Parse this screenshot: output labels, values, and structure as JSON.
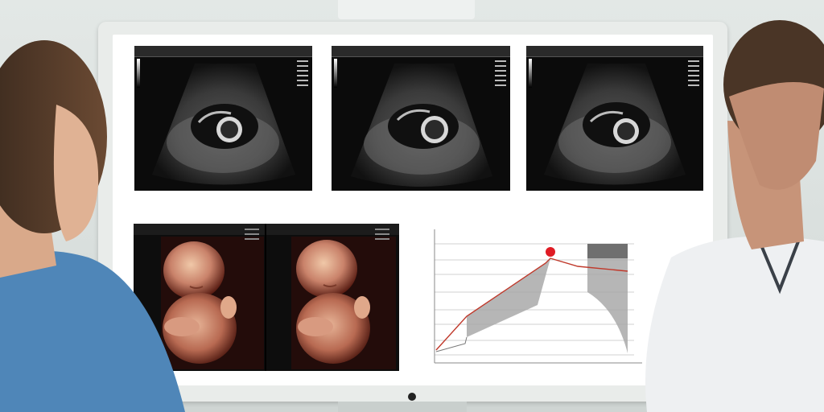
{
  "colors": {
    "wall": "#dde3e1",
    "monitor_bezel": "#e9ecea",
    "screen": "#ffffff",
    "ultrasound_bg": "#0b0b0b",
    "chart_fill": "#a9a9a9",
    "chart_line": "#c0392b",
    "marker": "#e01b24",
    "scrub_blue": "#4f86b8",
    "lab_coat": "#eef0f2"
  },
  "icons": {
    "webcam": "webcam-icon",
    "marker": "marker-dot-icon"
  },
  "ultrasound_scans": [
    {
      "id": "scan-1"
    },
    {
      "id": "scan-2"
    },
    {
      "id": "scan-3"
    }
  ],
  "renders_3d": [
    {
      "id": "render-1"
    },
    {
      "id": "render-2"
    }
  ]
}
